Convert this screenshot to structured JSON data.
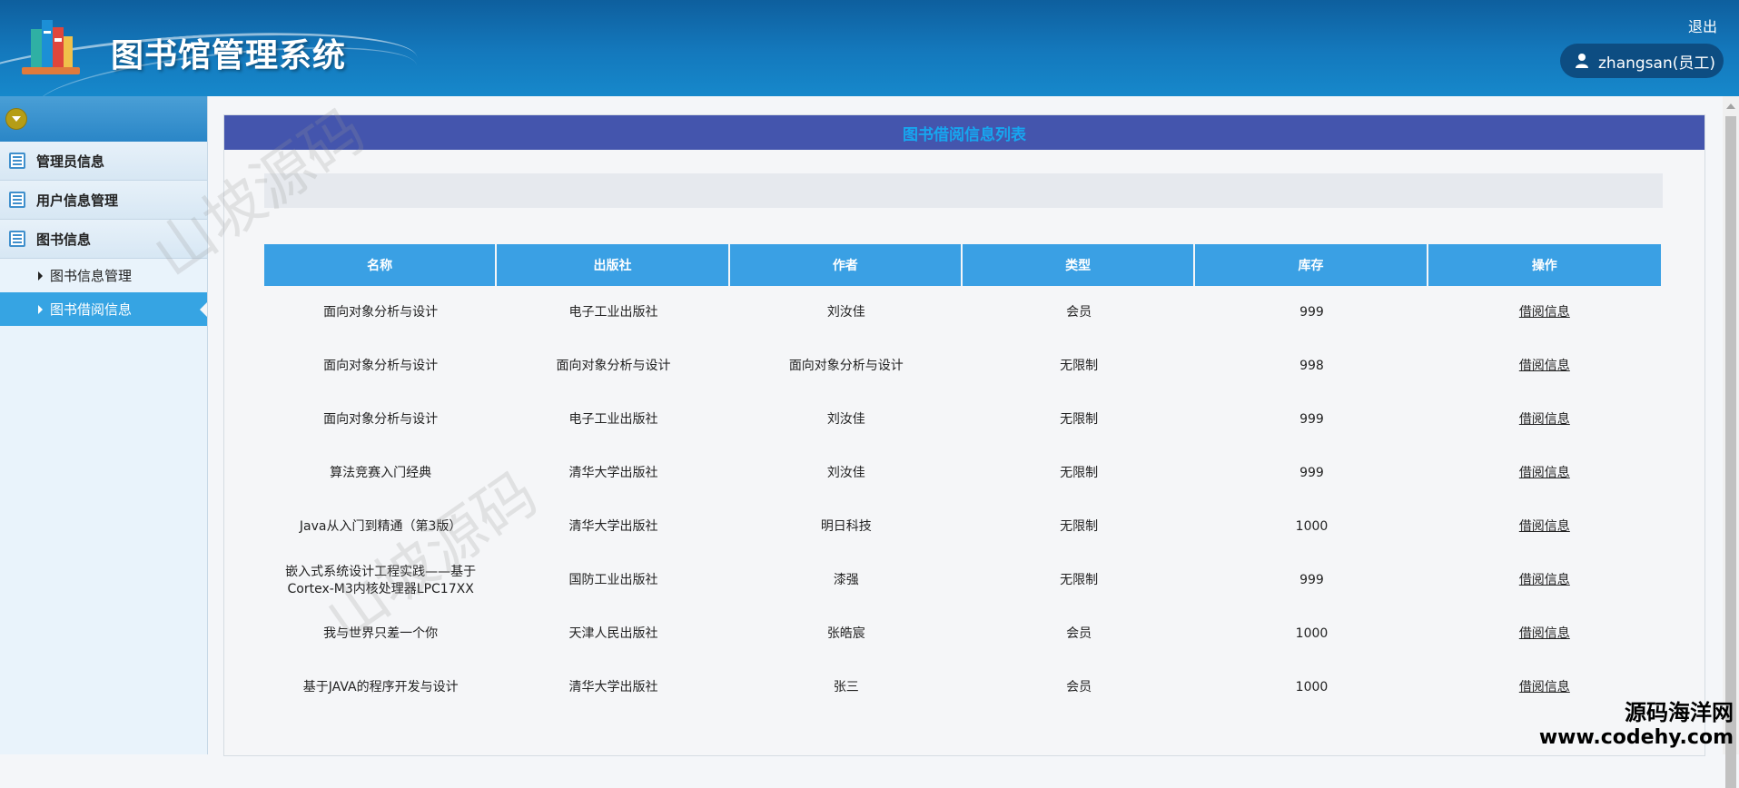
{
  "header": {
    "title": "图书馆管理系统",
    "logout_label": "退出",
    "user_label": "zhangsan(员工)"
  },
  "sidebar": {
    "items": [
      {
        "label": "管理员信息",
        "icon": "list-icon"
      },
      {
        "label": "用户信息管理",
        "icon": "list-icon"
      },
      {
        "label": "图书信息",
        "icon": "list-icon"
      }
    ],
    "subitems": [
      {
        "label": "图书信息管理"
      },
      {
        "label": "图书借阅信息",
        "active": true
      }
    ]
  },
  "main": {
    "panel_title": "图书借阅信息列表",
    "table": {
      "headers": [
        "名称",
        "出版社",
        "作者",
        "类型",
        "库存",
        "操作"
      ],
      "rows": [
        {
          "name": "面向对象分析与设计",
          "publisher": "电子工业出版社",
          "author": "刘汝佳",
          "type": "会员",
          "stock": "999",
          "action": "借阅信息"
        },
        {
          "name": "面向对象分析与设计",
          "publisher": "面向对象分析与设计",
          "author": "面向对象分析与设计",
          "type": "无限制",
          "stock": "998",
          "action": "借阅信息"
        },
        {
          "name": "面向对象分析与设计",
          "publisher": "电子工业出版社",
          "author": "刘汝佳",
          "type": "无限制",
          "stock": "999",
          "action": "借阅信息"
        },
        {
          "name": "算法竞赛入门经典",
          "publisher": "清华大学出版社",
          "author": "刘汝佳",
          "type": "无限制",
          "stock": "999",
          "action": "借阅信息"
        },
        {
          "name": "Java从入门到精通（第3版）",
          "publisher": "清华大学出版社",
          "author": "明日科技",
          "type": "无限制",
          "stock": "1000",
          "action": "借阅信息"
        },
        {
          "name": "嵌入式系统设计工程实践——基于Cortex-M3内核处理器LPC17XX",
          "publisher": "国防工业出版社",
          "author": "漆强",
          "type": "无限制",
          "stock": "999",
          "action": "借阅信息"
        },
        {
          "name": "我与世界只差一个你",
          "publisher": "天津人民出版社",
          "author": "张皓宸",
          "type": "会员",
          "stock": "1000",
          "action": "借阅信息"
        },
        {
          "name": "基于JAVA的程序开发与设计",
          "publisher": "清华大学出版社",
          "author": "张三",
          "type": "会员",
          "stock": "1000",
          "action": "借阅信息"
        }
      ]
    }
  },
  "watermarks": {
    "diagonal": "山坡源码",
    "corner_line1": "源码海洋网",
    "corner_line2": "www.codehy.com"
  },
  "colors": {
    "header_blue": "#1479bd",
    "panel_title_bg": "#4455ad",
    "panel_title_text": "#17a6ef",
    "table_header_bg": "#3aa0e4",
    "active_menu_bg": "#36a4e3"
  }
}
